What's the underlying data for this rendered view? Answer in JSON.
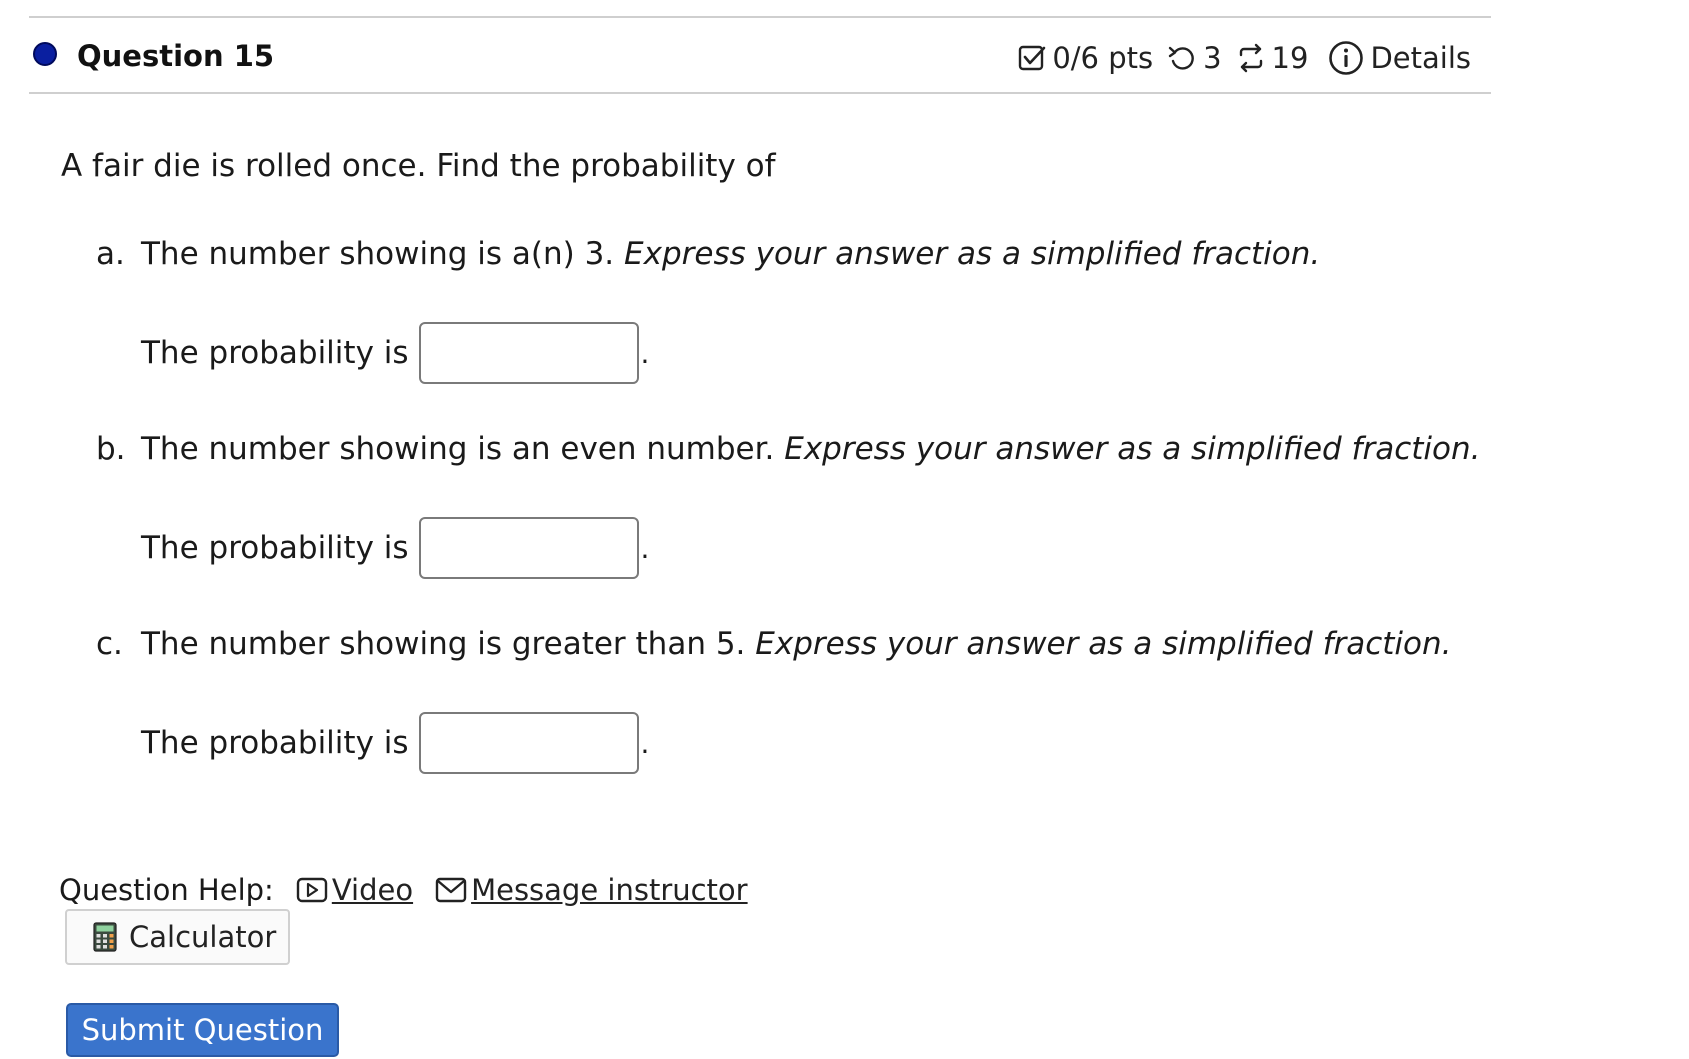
{
  "question": {
    "title": "Question 15",
    "points": "0/6 pts",
    "attempts": "3",
    "versions": "19",
    "details_label": "Details"
  },
  "body": {
    "intro": "A fair die is rolled once. Find the probability of",
    "parts": [
      {
        "label": "a.",
        "text": "The number showing is a(n) 3.",
        "instruction": "Express your answer as a simplified fraction.",
        "answer_prefix": "The probability is",
        "answer_value": "",
        "answer_suffix": "."
      },
      {
        "label": "b.",
        "text": "The number showing is an even number.",
        "instruction": "Express your answer as a simplified fraction.",
        "answer_prefix": "The probability is",
        "answer_value": "",
        "answer_suffix": "."
      },
      {
        "label": "c.",
        "text": "The number showing is greater than 5.",
        "instruction": "Express your answer as a simplified fraction.",
        "answer_prefix": "The probability is",
        "answer_value": "",
        "answer_suffix": "."
      }
    ]
  },
  "help": {
    "label": "Question Help:",
    "video_label": "Video",
    "message_label": "Message instructor"
  },
  "calculator_label": "Calculator",
  "submit_label": "Submit Question",
  "icons": {
    "status": "status-dot-icon",
    "points": "checkbox-icon",
    "attempts": "retry-icon",
    "versions": "shuffle-icon",
    "details": "info-icon",
    "video": "video-play-icon",
    "message": "envelope-icon",
    "calculator": "calculator-icon"
  },
  "colors": {
    "status_dot": "#0a1fa0",
    "submit_bg": "#3a74cc",
    "divider": "#cfcfcf"
  }
}
